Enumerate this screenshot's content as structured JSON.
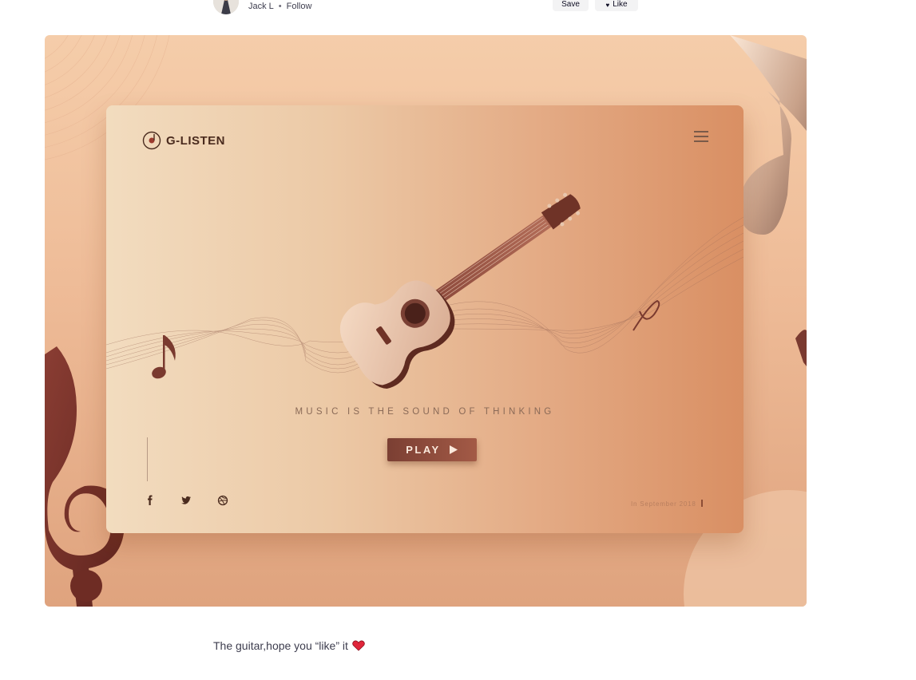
{
  "header": {
    "author_name": "Jack L",
    "separator": "•",
    "follow_label": "Follow",
    "save_label": "Save",
    "like_label": "Like"
  },
  "shot": {
    "brand": "G-LISTEN",
    "tagline": "MUSIC IS THE SOUND OF THINKING",
    "play_label": "PLAY",
    "date": "In September 2018",
    "social_icons": [
      "facebook-icon",
      "twitter-icon",
      "dribbble-icon"
    ],
    "colors": {
      "background": "#f5cdaa",
      "card_light": "#f2dcbf",
      "card_dark": "#d98f63",
      "accent": "#7b3f33"
    }
  },
  "description": {
    "text": "The guitar,hope you “like” it"
  }
}
